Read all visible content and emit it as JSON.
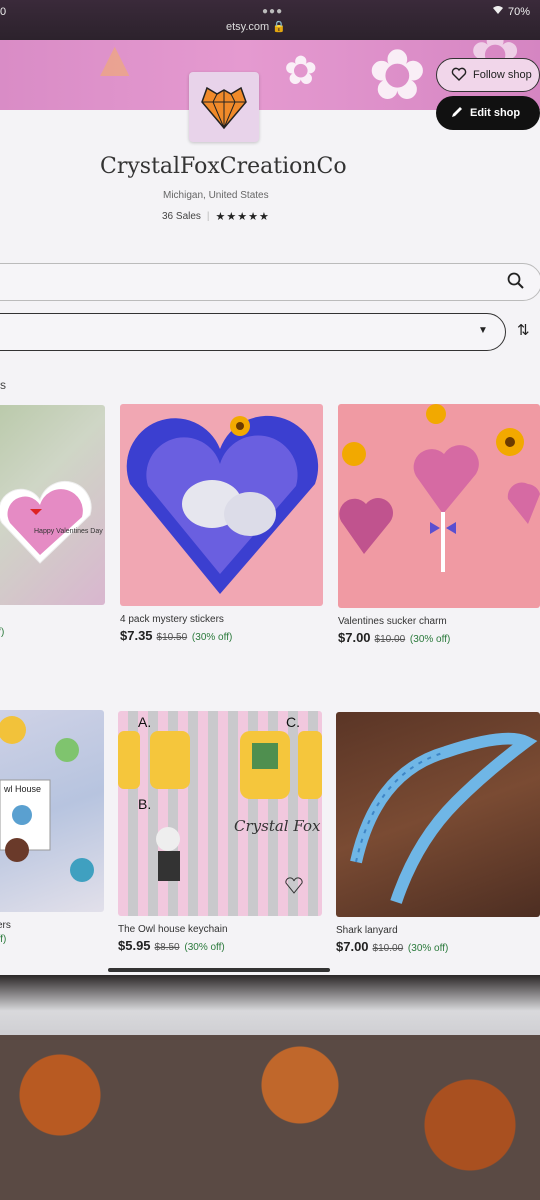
{
  "status_bar": {
    "time": "0",
    "battery": "70%",
    "url": "etsy.com"
  },
  "shop": {
    "name": "CrystalFoxCreationCo",
    "location": "Michigan, United States",
    "sales": "36 Sales",
    "rating_stars": "★★★★★"
  },
  "buttons": {
    "follow": "Follow shop",
    "edit": "Edit shop"
  },
  "section_label": "s",
  "listings": [
    {
      "title": "",
      "price": "",
      "old_price": "",
      "discount": "off)"
    },
    {
      "title": "4 pack mystery stickers",
      "price": "$7.35",
      "old_price": "$10.50",
      "discount": "(30% off)"
    },
    {
      "title": "Valentines sucker charm",
      "price": "$7.00",
      "old_price": "$10.00",
      "discount": "(30% off)"
    },
    {
      "title": "kers",
      "price": "",
      "old_price": "",
      "discount": "off)"
    },
    {
      "title": "The Owl house keychain",
      "price": "$5.95",
      "old_price": "$8.50",
      "discount": "(30% off)"
    },
    {
      "title": "Shark lanyard",
      "price": "$7.00",
      "old_price": "$10.00",
      "discount": "(30% off)"
    }
  ],
  "image_text": {
    "valentine_card": "Happy Valentines Day",
    "owl_house": "wl House",
    "keychain_labels": [
      "A.",
      "B.",
      "C."
    ],
    "crystal_fox": "Crystal Fox Creation"
  },
  "colors": {
    "banner": "#e59ad0",
    "discount_green": "#2b7a3c",
    "button_dark": "#111111"
  }
}
